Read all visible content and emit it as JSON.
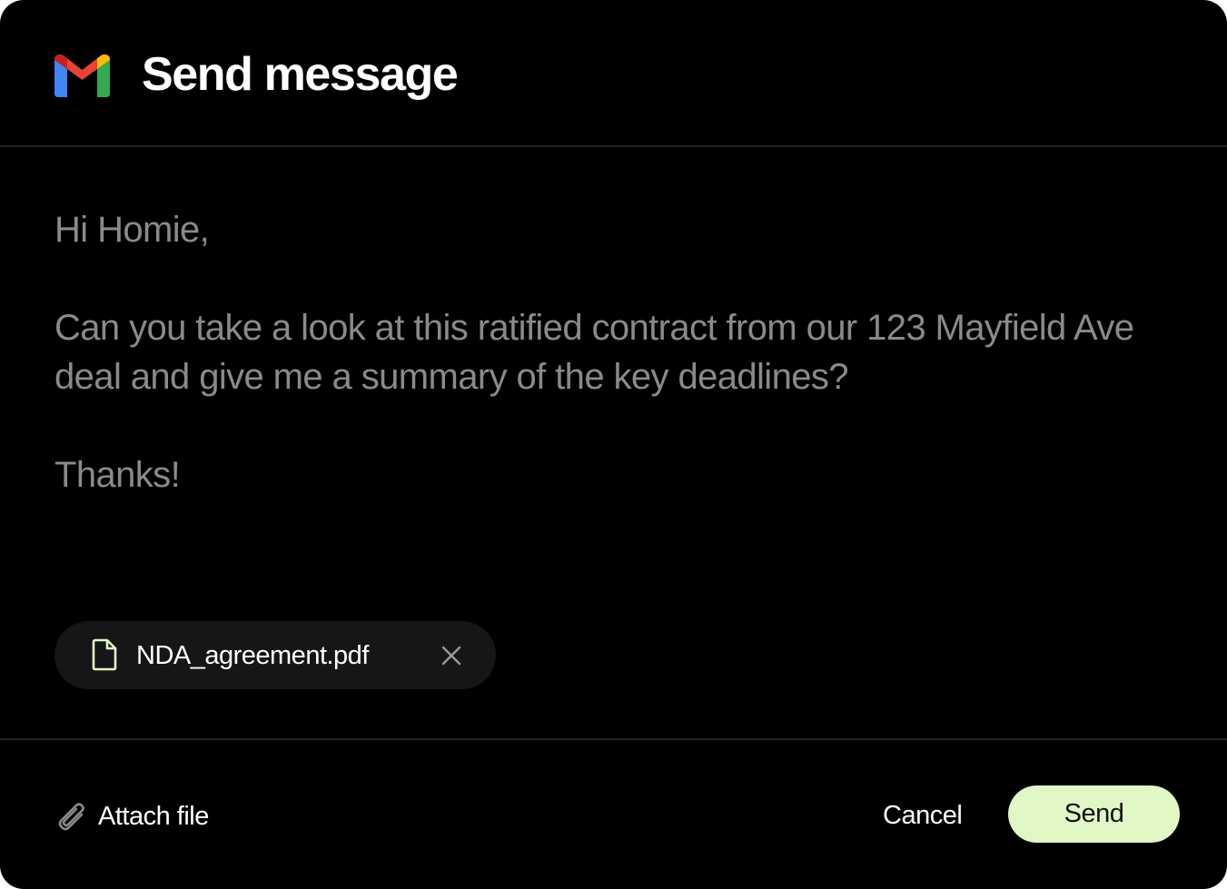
{
  "dialog": {
    "title": "Send message",
    "logo_icon": "gmail-logo-icon"
  },
  "message": {
    "greeting": "Hi Homie,",
    "body": "Can you take a look at this ratified contract from our 123 Mayfield Ave deal and give me a summary of the key deadlines?",
    "closing": "Thanks!"
  },
  "attachment": {
    "file_name": "NDA_agreement.pdf",
    "file_icon": "document-icon",
    "remove_icon": "close-icon"
  },
  "footer": {
    "attach_label": "Attach file",
    "attach_icon": "paperclip-icon",
    "cancel_label": "Cancel",
    "send_label": "Send"
  },
  "colors": {
    "background": "#000000",
    "body_text": "#8a8a8a",
    "send_button": "#e1f7c6",
    "gmail_red": "#EA4335",
    "gmail_blue": "#4285F4",
    "gmail_green": "#34A853",
    "gmail_yellow": "#FBBC04"
  }
}
